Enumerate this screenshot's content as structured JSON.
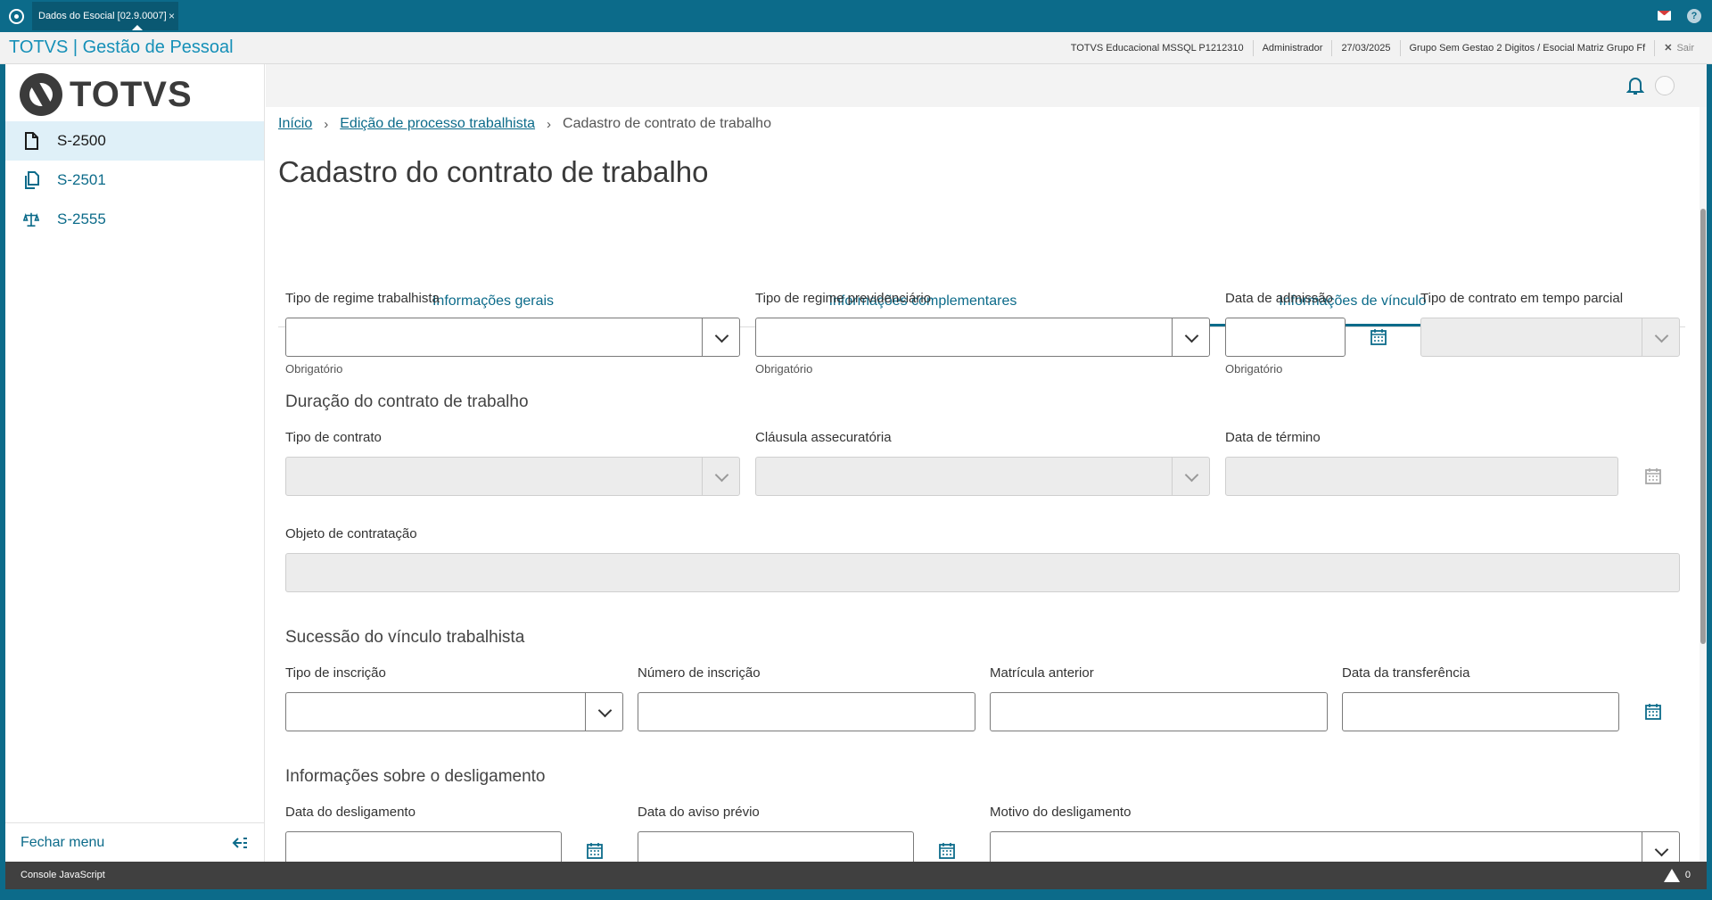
{
  "window": {
    "tab_title": "Dados do Esocial [02.9.0007]",
    "tab_close": "×",
    "icons": [
      "app-logo-icon",
      "mail-icon",
      "help-icon"
    ],
    "help_glyph": "?"
  },
  "app_header": {
    "brand": "TOTVS | Gestão de Pessoal",
    "environment": "TOTVS Educacional MSSQL P1212310",
    "user": "Administrador",
    "date": "27/03/2025",
    "company": "Grupo Sem Gestao 2 Digitos / Esocial Matriz Grupo Ff",
    "logout_glyph": "✕",
    "logout_label": "Sair"
  },
  "sidebar": {
    "logo_text": "TOTVS",
    "items": [
      {
        "label": "S-2500",
        "icon": "document-icon",
        "active": true
      },
      {
        "label": "S-2501",
        "icon": "copy-document-icon",
        "active": false
      },
      {
        "label": "S-2555",
        "icon": "scale-icon",
        "active": false
      }
    ],
    "close_menu": "Fechar menu",
    "close_menu_icon": "collapse-menu-icon"
  },
  "breadcrumb": {
    "home": "Início",
    "parent": "Edição de processo trabalhista",
    "current": "Cadastro de contrato de trabalho",
    "separator": "›"
  },
  "page_title": "Cadastro do contrato de trabalho",
  "tabs": [
    {
      "label": "Informações gerais",
      "active": false
    },
    {
      "label": "Informações complementares",
      "active": false
    },
    {
      "label": "Informações de vínculo",
      "active": true
    }
  ],
  "form": {
    "tipo_regime_trabalhista": {
      "label": "Tipo de regime trabalhista",
      "value": "",
      "hint": "Obrigatório"
    },
    "tipo_regime_previdenciario": {
      "label": "Tipo de regime previdenciário",
      "value": "",
      "hint": "Obrigatório"
    },
    "data_admissao": {
      "label": "Data de admissão",
      "value": "",
      "hint": "Obrigatório"
    },
    "tipo_contrato_parcial": {
      "label": "Tipo de contrato em tempo parcial",
      "value": "",
      "disabled": true
    },
    "duracao_section": "Duração do contrato de trabalho",
    "tipo_contrato": {
      "label": "Tipo de contrato",
      "value": "",
      "disabled": true
    },
    "clausula": {
      "label": "Cláusula assecuratória",
      "value": "",
      "disabled": true
    },
    "data_termino": {
      "label": "Data de término",
      "value": "",
      "disabled": true
    },
    "objeto": {
      "label": "Objeto de contratação",
      "value": "",
      "disabled": true
    },
    "sucessao_section": "Sucessão do vínculo trabalhista",
    "tipo_inscricao": {
      "label": "Tipo de inscrição",
      "value": ""
    },
    "numero_inscricao": {
      "label": "Número de inscrição",
      "value": ""
    },
    "matricula_anterior": {
      "label": "Matrícula anterior",
      "value": ""
    },
    "data_transferencia": {
      "label": "Data da transferência",
      "value": ""
    },
    "desligamento_section": "Informações sobre o desligamento",
    "data_desligamento": {
      "label": "Data do desligamento",
      "value": ""
    },
    "data_aviso": {
      "label": "Data do aviso prévio",
      "value": ""
    },
    "motivo": {
      "label": "Motivo do desligamento",
      "value": ""
    }
  },
  "console": {
    "label": "Console JavaScript",
    "warning_count": "0",
    "warning_glyph": "!"
  },
  "colors": {
    "primary": "#0c6b8a",
    "brand": "#1690b8",
    "active_item_bg": "#dff0f8"
  }
}
